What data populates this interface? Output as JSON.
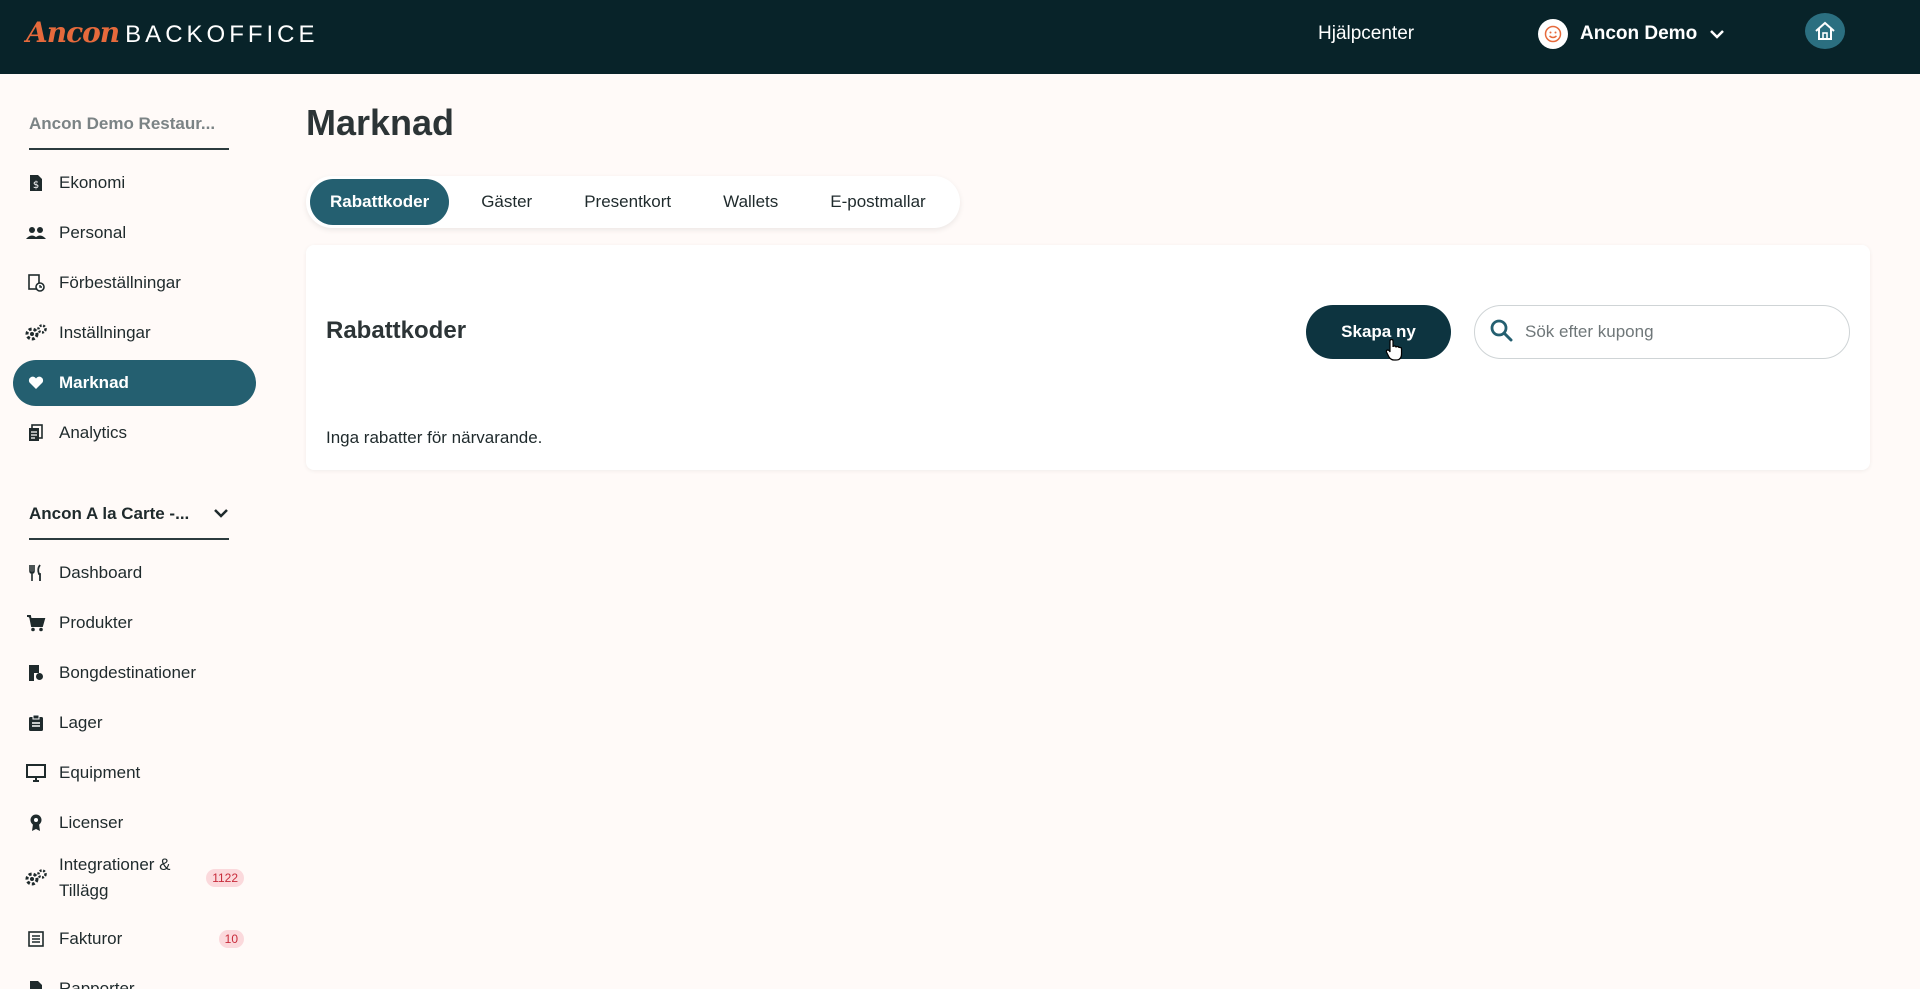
{
  "header": {
    "logo_brand": "Ancon",
    "logo_rest": "BACKOFFICE",
    "help_label": "Hjälpcenter",
    "user_name": "Ancon Demo"
  },
  "sidebar": {
    "org_selector": "Ancon Demo Restaur...",
    "location_selector": "Ancon A la Carte -...",
    "top_items": [
      {
        "label": "Ekonomi",
        "icon": "finance-icon"
      },
      {
        "label": "Personal",
        "icon": "people-icon"
      },
      {
        "label": "Förbeställningar",
        "icon": "preorder-icon"
      },
      {
        "label": "Inställningar",
        "icon": "settings-icon"
      },
      {
        "label": "Marknad",
        "icon": "heart-icon",
        "active": true
      },
      {
        "label": "Analytics",
        "icon": "analytics-icon"
      }
    ],
    "location_items": [
      {
        "label": "Dashboard",
        "icon": "cutlery-icon"
      },
      {
        "label": "Produkter",
        "icon": "cart-icon"
      },
      {
        "label": "Bongdestinationer",
        "icon": "receipt-icon"
      },
      {
        "label": "Lager",
        "icon": "clipboard-icon"
      },
      {
        "label": "Equipment",
        "icon": "monitor-icon"
      },
      {
        "label": "Licenser",
        "icon": "license-icon"
      },
      {
        "label": "Integrationer & Tillägg",
        "icon": "settings-icon",
        "badge": "1122"
      },
      {
        "label": "Fakturor",
        "icon": "invoice-icon",
        "badge": "10"
      },
      {
        "label": "Rapporter",
        "icon": "report-icon"
      }
    ]
  },
  "main": {
    "page_title": "Marknad",
    "tabs": [
      "Rabattkoder",
      "Gäster",
      "Presentkort",
      "Wallets",
      "E-postmallar"
    ],
    "active_tab": "Rabattkoder",
    "card": {
      "title": "Rabattkoder",
      "create_label": "Skapa ny",
      "search_placeholder": "Sök efter kupong",
      "empty_message": "Inga rabatter för närvarande."
    }
  },
  "colors": {
    "topbar": "#082329",
    "accent": "#245f70",
    "brand_orange": "#e66a3c",
    "badge_bg": "#fbd9dc",
    "badge_text": "#c82b3a"
  }
}
